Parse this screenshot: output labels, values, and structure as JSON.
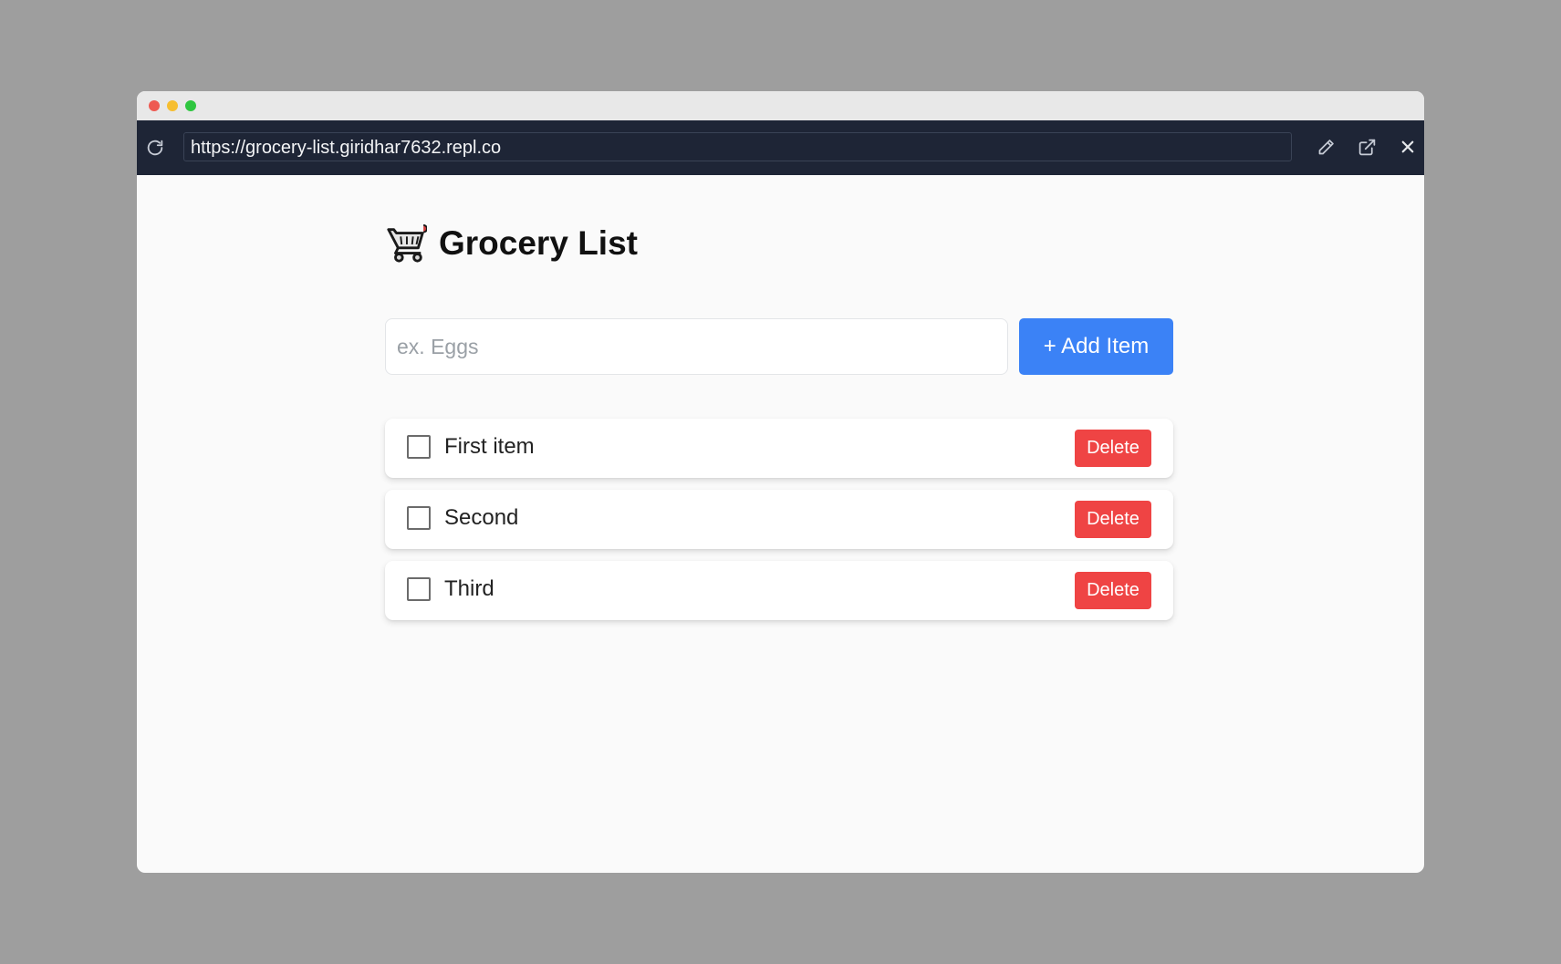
{
  "browser": {
    "url": "https://grocery-list.giridhar7632.repl.co",
    "icons": {
      "reload": "reload-icon",
      "edit": "pencil-icon",
      "open_external": "external-link-icon",
      "close": "close-icon"
    },
    "colors": {
      "toolbar_bg": "#1e2536",
      "traffic_red": "#ee5a52",
      "traffic_yellow": "#f6be30",
      "traffic_green": "#2fc640"
    }
  },
  "app": {
    "title": "Grocery List",
    "title_icon": "shopping-cart-icon",
    "input": {
      "placeholder": "ex. Eggs",
      "value": ""
    },
    "add_button_label": "+ Add Item",
    "items": [
      {
        "label": "First item",
        "checked": false,
        "delete_label": "Delete"
      },
      {
        "label": "Second",
        "checked": false,
        "delete_label": "Delete"
      },
      {
        "label": "Third",
        "checked": false,
        "delete_label": "Delete"
      }
    ],
    "colors": {
      "primary": "#3b82f6",
      "danger": "#ef4444"
    }
  }
}
